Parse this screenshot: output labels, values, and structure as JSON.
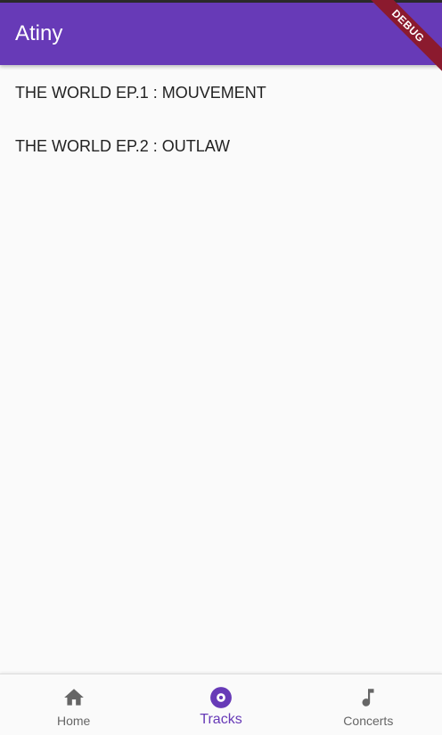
{
  "app_bar": {
    "title": "Atiny",
    "debug_label": "DEBUG"
  },
  "albums": [
    {
      "title": "THE WORLD EP.1 : MOUVEMENT"
    },
    {
      "title": "THE WORLD EP.2 : OUTLAW"
    }
  ],
  "bottom_nav": {
    "selected": "Tracks",
    "items": [
      {
        "label": "Home",
        "icon": "home-icon"
      },
      {
        "label": "Tracks",
        "icon": "disc-icon"
      },
      {
        "label": "Concerts",
        "icon": "music-note-icon"
      }
    ]
  },
  "colors": {
    "primary": "#673ab7",
    "debug_banner": "#8b1a2e",
    "inactive": "#666666",
    "background": "#fafafa"
  }
}
